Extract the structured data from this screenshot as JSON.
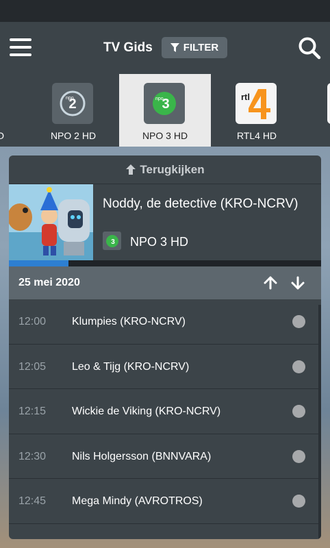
{
  "app": {
    "title": "TV Gids",
    "filter_label": "FILTER"
  },
  "channels": [
    {
      "name": "O",
      "logo": "npo1-icon",
      "active": false
    },
    {
      "name": "NPO 2 HD",
      "logo": "npo2-icon",
      "active": false
    },
    {
      "name": "NPO 3 HD",
      "logo": "npo3-icon",
      "active": true
    },
    {
      "name": "RTL4 HD",
      "logo": "rtl4-icon",
      "active": false
    }
  ],
  "now_playing": {
    "back_label": "Terugkijken",
    "title": "Noddy, de detective (KRO-NCRV)",
    "channel": "NPO 3 HD",
    "progress_fraction": 0.19
  },
  "schedule": {
    "date": "25 mei 2020",
    "items": [
      {
        "time": "12:00",
        "title": "Klumpies (KRO-NCRV)"
      },
      {
        "time": "12:05",
        "title": "Leo & Tijg (KRO-NCRV)"
      },
      {
        "time": "12:15",
        "title": "Wickie de Viking (KRO-NCRV)"
      },
      {
        "time": "12:30",
        "title": "Nils Holgersson (BNNVARA)"
      },
      {
        "time": "12:45",
        "title": "Mega Mindy (AVROTROS)"
      }
    ]
  },
  "colors": {
    "accent": "#2d7fd2",
    "npo_green": "#3ab54a",
    "rtl_orange": "#f7941d"
  }
}
